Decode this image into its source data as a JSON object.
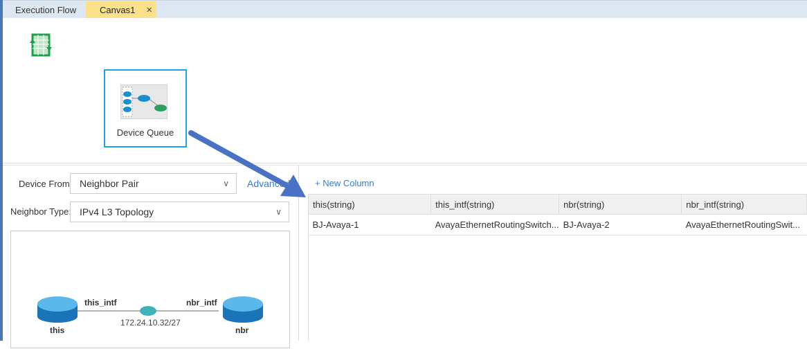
{
  "tabs": [
    {
      "label": "Execution Flow"
    },
    {
      "label": "Canvas1",
      "close": "×"
    }
  ],
  "canvas": {
    "node_label": "Device Queue"
  },
  "form": {
    "device_from_label": "Device From:",
    "device_from_value": "Neighbor Pair",
    "neighbor_type_label": "Neighbor Type:",
    "neighbor_type_value": "IPv4 L3 Topology",
    "advanced_link": "Advanced",
    "chevron": "∨"
  },
  "topology": {
    "this": "this",
    "nbr": "nbr",
    "this_intf": "this_intf",
    "nbr_intf": "nbr_intf",
    "subnet": "172.24.10.32/27"
  },
  "table": {
    "new_column": "+ New Column",
    "headers": [
      "this(string)",
      "this_intf(string)",
      "nbr(string)",
      "nbr_intf(string)"
    ],
    "rows": [
      [
        "BJ-Avaya-1",
        "AvayaEthernetRoutingSwitch...",
        "BJ-Avaya-2",
        "AvayaEthernetRoutingSwit..."
      ]
    ]
  },
  "colors": {
    "accent": "#1aa3e8",
    "active_tab": "#fde08a",
    "arrow": "#4a72c4",
    "link": "#3a7bc8"
  }
}
